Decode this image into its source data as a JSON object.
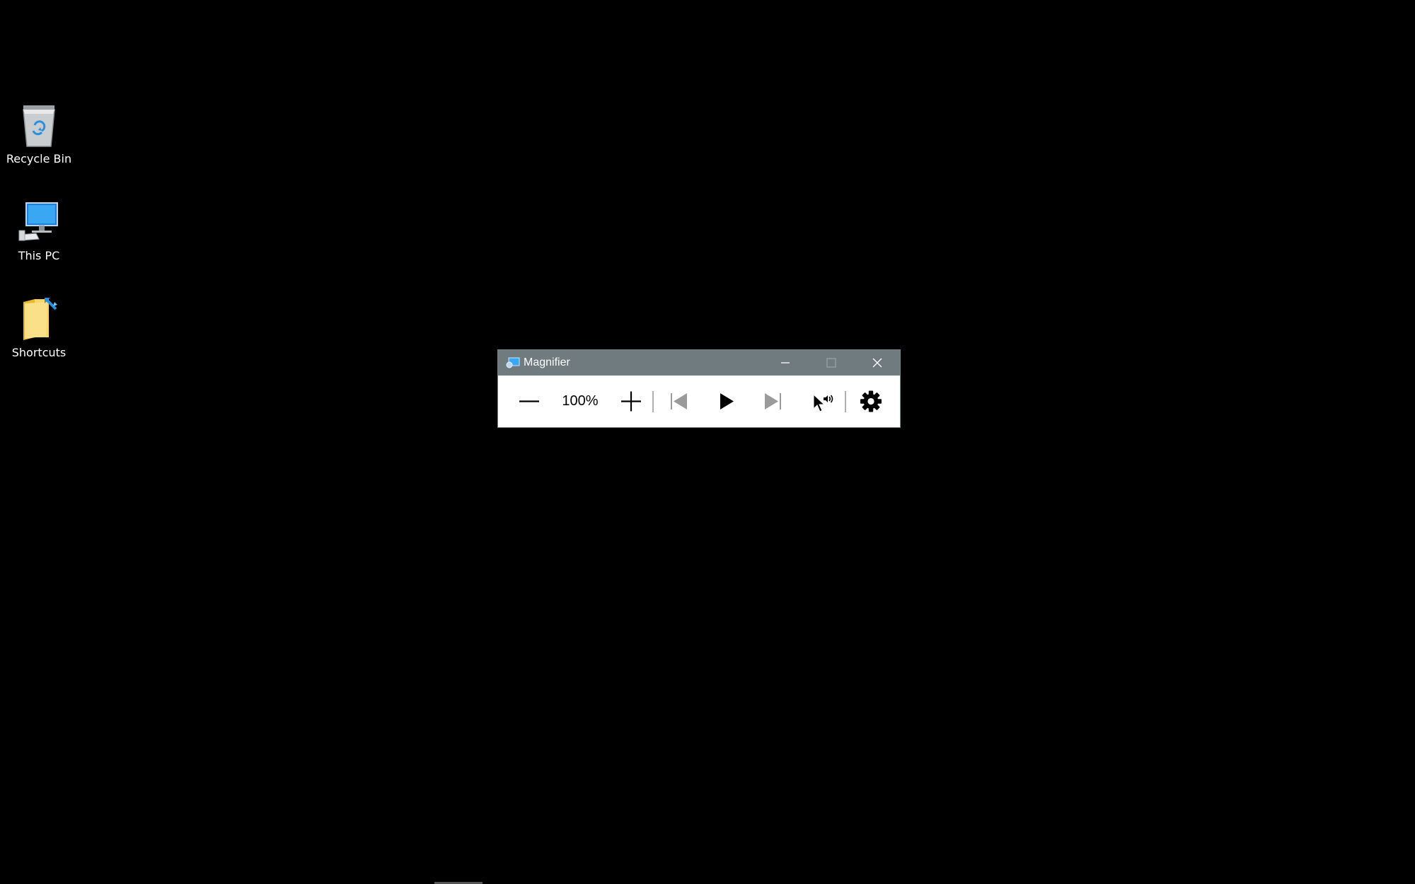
{
  "desktop": {
    "background_color": "#000000",
    "icons": [
      {
        "label": "Recycle Bin",
        "icon": "recycle-bin-icon"
      },
      {
        "label": "This PC",
        "icon": "this-pc-icon"
      },
      {
        "label": "Shortcuts",
        "icon": "shortcut-folder-icon"
      }
    ]
  },
  "magnifier": {
    "title": "Magnifier",
    "app_icon": "magnifier-app-icon",
    "titlebar_color": "#6f7b7e",
    "caption_buttons": {
      "minimize": "minimize-icon",
      "maximize": "maximize-icon",
      "close": "close-icon"
    },
    "toolbar": {
      "zoom_level": "100%",
      "buttons": [
        {
          "name": "zoom-out",
          "icon": "minus-icon",
          "enabled": true
        },
        {
          "name": "zoom-in",
          "icon": "plus-icon",
          "enabled": true
        },
        {
          "name": "previous-paragraph",
          "icon": "skip-back-icon",
          "enabled": false
        },
        {
          "name": "play",
          "icon": "play-icon",
          "enabled": true
        },
        {
          "name": "next-paragraph",
          "icon": "skip-forward-icon",
          "enabled": false
        },
        {
          "name": "read-from-here",
          "icon": "pointer-speaker-icon",
          "enabled": true
        },
        {
          "name": "settings",
          "icon": "gear-icon",
          "enabled": true
        }
      ]
    }
  }
}
